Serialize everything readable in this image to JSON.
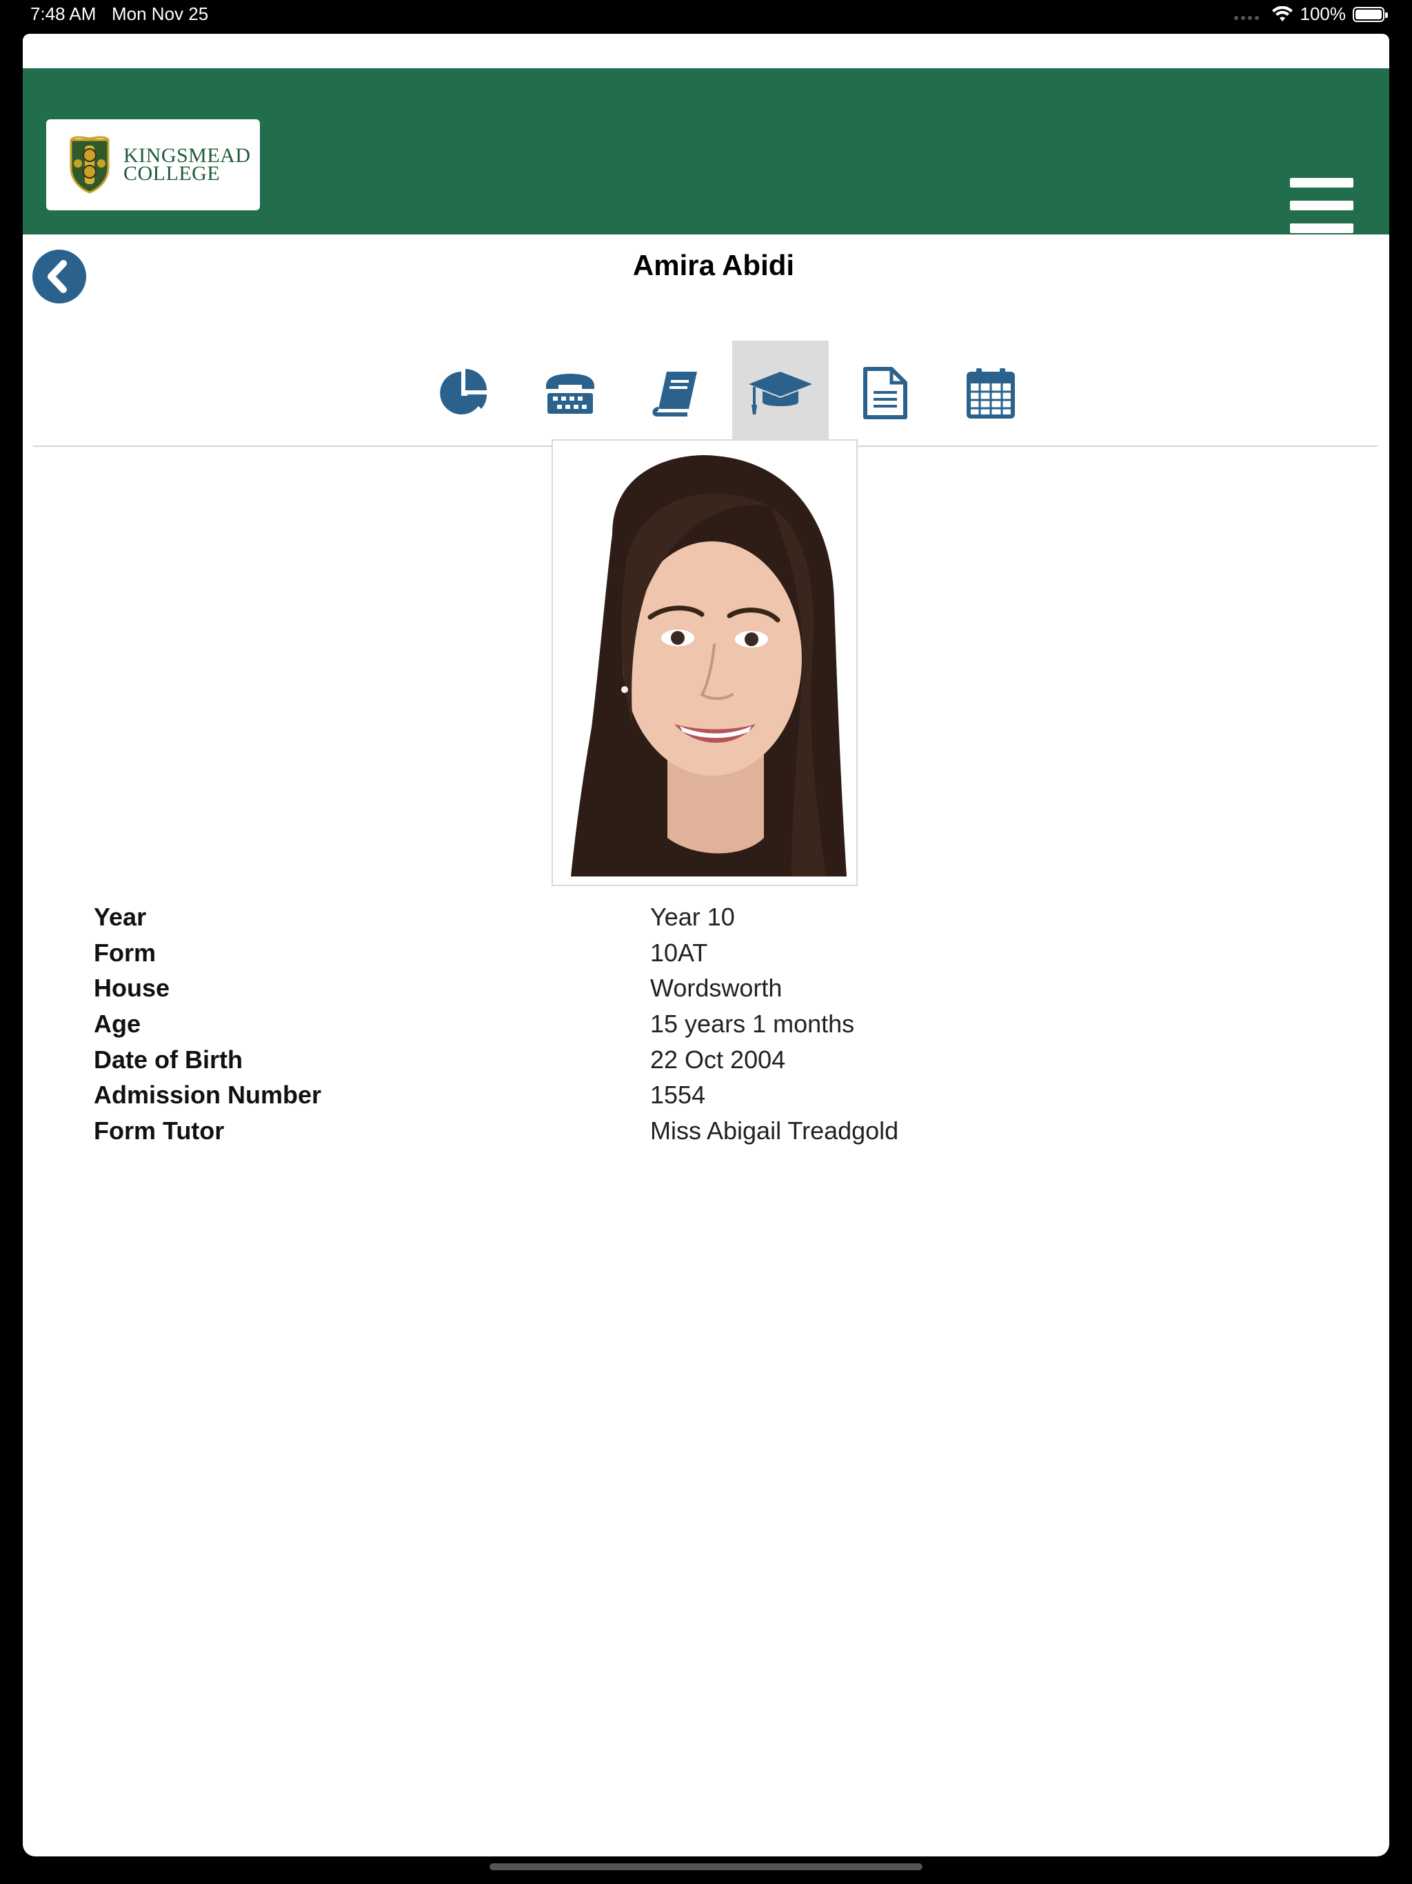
{
  "status_bar": {
    "time": "7:48 AM",
    "date": "Mon Nov 25",
    "battery": "100%"
  },
  "header": {
    "logo_line1": "KINGSMEAD",
    "logo_line2": "COLLEGE",
    "menu_icon": "hamburger-icon"
  },
  "student": {
    "name": "Amira Abidi",
    "photo_icon": "student-photo"
  },
  "tabs": [
    {
      "icon": "pie-chart-icon",
      "active": false
    },
    {
      "icon": "telephone-icon",
      "active": false
    },
    {
      "icon": "book-icon",
      "active": false
    },
    {
      "icon": "graduation-cap-icon",
      "active": true
    },
    {
      "icon": "document-icon",
      "active": false
    },
    {
      "icon": "calendar-icon",
      "active": false
    }
  ],
  "details": [
    {
      "label": "Year",
      "value": "Year 10"
    },
    {
      "label": "Form",
      "value": "10AT"
    },
    {
      "label": "House",
      "value": "Wordsworth"
    },
    {
      "label": "Age",
      "value": "15 years 1 months"
    },
    {
      "label": "Date of Birth",
      "value": "22 Oct 2004"
    },
    {
      "label": "Admission Number",
      "value": "1554"
    },
    {
      "label": "Form Tutor",
      "value": "Miss Abigail Treadgold"
    }
  ],
  "colors": {
    "header_green": "#226d4b",
    "icon_blue": "#2a628d",
    "active_tab_bg": "#dcdcdc"
  }
}
